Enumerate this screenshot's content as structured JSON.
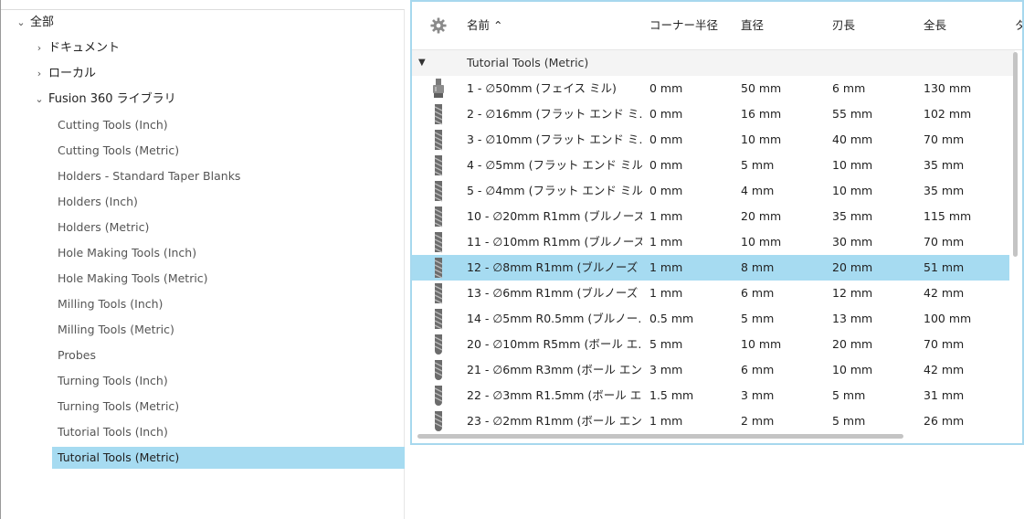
{
  "tree": {
    "root": "全部",
    "nodes": [
      {
        "label": "ドキュメント",
        "chev": "›"
      },
      {
        "label": "ローカル",
        "chev": "›"
      },
      {
        "label": "Fusion 360 ライブラリ",
        "chev": "⌄"
      }
    ],
    "libraries": [
      "Cutting Tools (Inch)",
      "Cutting Tools (Metric)",
      "Holders - Standard Taper Blanks",
      "Holders (Inch)",
      "Holders (Metric)",
      "Hole Making Tools (Inch)",
      "Hole Making Tools (Metric)",
      "Milling Tools (Inch)",
      "Milling Tools (Metric)",
      "Probes",
      "Turning Tools (Inch)",
      "Turning Tools (Metric)",
      "Tutorial Tools (Inch)",
      "Tutorial Tools (Metric)"
    ],
    "selected_library": "Tutorial Tools (Metric)"
  },
  "table": {
    "columns": [
      "名前 ⌃",
      "コーナー半径",
      "直径",
      "刃長",
      "全長",
      "タ"
    ],
    "group_label": "Tutorial Tools (Metric)",
    "rows": [
      {
        "name": "1 - ∅50mm (フェイス ミル)",
        "corner": "0 mm",
        "diameter": "50 mm",
        "flute": "6 mm",
        "overall": "130 mm",
        "icon": "face-mill"
      },
      {
        "name": "2 - ∅16mm (フラット エンド ミ…",
        "corner": "0 mm",
        "diameter": "16 mm",
        "flute": "55 mm",
        "overall": "102 mm",
        "icon": "end-mill"
      },
      {
        "name": "3 - ∅10mm (フラット エンド ミ…",
        "corner": "0 mm",
        "diameter": "10 mm",
        "flute": "40 mm",
        "overall": "70 mm",
        "icon": "end-mill"
      },
      {
        "name": "4 - ∅5mm (フラット エンド ミル)",
        "corner": "0 mm",
        "diameter": "5 mm",
        "flute": "10 mm",
        "overall": "35 mm",
        "icon": "end-mill"
      },
      {
        "name": "5 - ∅4mm (フラット エンド ミル)",
        "corner": "0 mm",
        "diameter": "4 mm",
        "flute": "10 mm",
        "overall": "35 mm",
        "icon": "end-mill"
      },
      {
        "name": "10 - ∅20mm R1mm (ブルノーズ…",
        "corner": "1 mm",
        "diameter": "20 mm",
        "flute": "35 mm",
        "overall": "115 mm",
        "icon": "end-mill"
      },
      {
        "name": "11 - ∅10mm R1mm (ブルノーズ …",
        "corner": "1 mm",
        "diameter": "10 mm",
        "flute": "30 mm",
        "overall": "70 mm",
        "icon": "end-mill"
      },
      {
        "name": "12 - ∅8mm R1mm (ブルノーズ …",
        "corner": "1 mm",
        "diameter": "8 mm",
        "flute": "20 mm",
        "overall": "51 mm",
        "icon": "end-mill",
        "selected": true
      },
      {
        "name": "13 - ∅6mm R1mm (ブルノーズ …",
        "corner": "1 mm",
        "diameter": "6 mm",
        "flute": "12 mm",
        "overall": "42 mm",
        "icon": "end-mill"
      },
      {
        "name": "14 - ∅5mm R0.5mm (ブルノー…",
        "corner": "0.5 mm",
        "diameter": "5 mm",
        "flute": "13 mm",
        "overall": "100 mm",
        "icon": "end-mill"
      },
      {
        "name": "20 - ∅10mm R5mm (ボール エ…",
        "corner": "5 mm",
        "diameter": "10 mm",
        "flute": "20 mm",
        "overall": "70 mm",
        "icon": "ball-mill"
      },
      {
        "name": "21 - ∅6mm R3mm (ボール エン…",
        "corner": "3 mm",
        "diameter": "6 mm",
        "flute": "10 mm",
        "overall": "42 mm",
        "icon": "ball-mill"
      },
      {
        "name": "22 - ∅3mm R1.5mm (ボール エ…",
        "corner": "1.5 mm",
        "diameter": "3 mm",
        "flute": "5 mm",
        "overall": "31 mm",
        "icon": "ball-mill"
      },
      {
        "name": "23 - ∅2mm R1mm (ボール エン…",
        "corner": "1 mm",
        "diameter": "2 mm",
        "flute": "5 mm",
        "overall": "26 mm",
        "icon": "ball-mill"
      }
    ]
  },
  "colors": {
    "selection": "#a6dbf1",
    "panel_border": "#a7d8ee"
  }
}
